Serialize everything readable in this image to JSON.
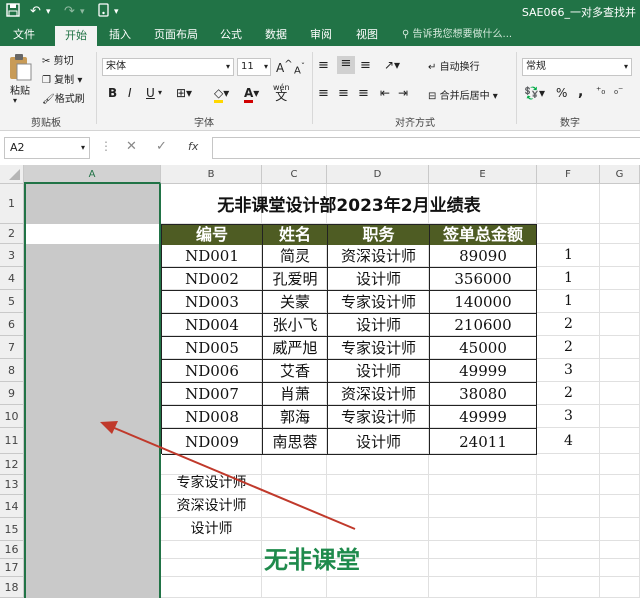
{
  "titlebar": {
    "doc_title": "SAE066_一对多查找并",
    "save_icon": "save-icon",
    "undo_icon": "undo-icon",
    "redo_icon": "redo-icon",
    "touch_icon": "touch-mode-icon",
    "color": "#217346"
  },
  "menu": {
    "tabs": [
      "文件",
      "开始",
      "插入",
      "页面布局",
      "公式",
      "数据",
      "审阅",
      "视图"
    ],
    "active": "开始",
    "tell_me": "告诉我您想要做什么..."
  },
  "ribbon": {
    "clipboard": {
      "paste": "粘贴",
      "cut": "剪切",
      "copy": "复制",
      "format_painter": "格式刷",
      "label": "剪贴板"
    },
    "font": {
      "name": "宋体",
      "size": "11",
      "bold": "B",
      "italic": "I",
      "underline": "U",
      "label": "字体",
      "grow": "A",
      "shrink": "A",
      "wen": "wén"
    },
    "alignment": {
      "wrap": "自动换行",
      "merge": "合并后居中",
      "label": "对齐方式"
    },
    "number": {
      "format": "常规",
      "percent": "%",
      "comma": ",",
      "label": "数字"
    }
  },
  "formula_bar": {
    "name_box": "A2",
    "cancel": "✕",
    "enter": "✓",
    "fx": "fx",
    "formula": ""
  },
  "grid": {
    "columns": [
      "A",
      "B",
      "C",
      "D",
      "E",
      "F",
      "G"
    ],
    "rows": [
      "1",
      "2",
      "3",
      "4",
      "5",
      "6",
      "7",
      "8",
      "9",
      "10",
      "11",
      "12",
      "13",
      "14",
      "15",
      "16",
      "17",
      "18"
    ],
    "title": "无非课堂设计部2023年2月业绩表",
    "headers": [
      "编号",
      "姓名",
      "职务",
      "签单总金额"
    ],
    "records": [
      {
        "id": "ND001",
        "name": "简灵",
        "role": "资深设计师",
        "amount": "89090",
        "f": "1"
      },
      {
        "id": "ND002",
        "name": "孔爱明",
        "role": "设计师",
        "amount": "356000",
        "f": "1"
      },
      {
        "id": "ND003",
        "name": "关蒙",
        "role": "专家设计师",
        "amount": "140000",
        "f": "1"
      },
      {
        "id": "ND004",
        "name": "张小飞",
        "role": "设计师",
        "amount": "210600",
        "f": "2"
      },
      {
        "id": "ND005",
        "name": "威严旭",
        "role": "专家设计师",
        "amount": "45000",
        "f": "2"
      },
      {
        "id": "ND006",
        "name": "艾香",
        "role": "设计师",
        "amount": "49999",
        "f": "3"
      },
      {
        "id": "ND007",
        "name": "肖萧",
        "role": "资深设计师",
        "amount": "38080",
        "f": "2"
      },
      {
        "id": "ND008",
        "name": "郭海",
        "role": "专家设计师",
        "amount": "49999",
        "f": "3"
      },
      {
        "id": "ND009",
        "name": "南思蓉",
        "role": "设计师",
        "amount": "24011",
        "f": "4"
      }
    ],
    "role_list": [
      "专家设计师",
      "资深设计师",
      "设计师"
    ],
    "watermark": "无非课堂",
    "header_fill": "#4e5c23",
    "selection_fill": "#c9c9c9",
    "arrow_color": "#c0392b"
  }
}
